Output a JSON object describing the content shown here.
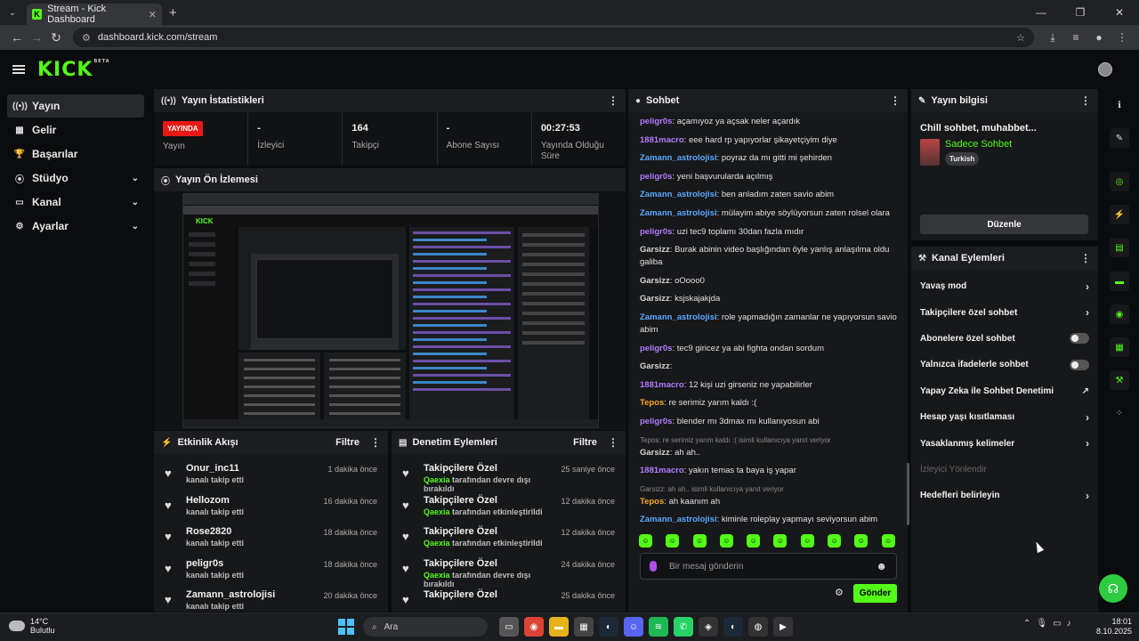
{
  "browser": {
    "tab_title": "Stream - Kick Dashboard",
    "url": "dashboard.kick.com/stream"
  },
  "brand": {
    "logo": "KICK",
    "beta": "BETA",
    "accent": "#53fc18"
  },
  "sidebar": {
    "items": [
      {
        "label": "Yayın",
        "icon": "broadcast-icon"
      },
      {
        "label": "Gelir",
        "icon": "revenue-icon"
      },
      {
        "label": "Başarılar",
        "icon": "trophy-icon"
      },
      {
        "label": "Stüdyo",
        "icon": "studio-icon"
      },
      {
        "label": "Kanal",
        "icon": "channel-icon"
      },
      {
        "label": "Ayarlar",
        "icon": "gear-icon"
      }
    ]
  },
  "stats": {
    "title": "Yayın İstatistikleri",
    "live": "YAYINDA",
    "live_label": "Yayın",
    "viewers": {
      "value": "-",
      "label": "İzleyici"
    },
    "followers": {
      "value": "164",
      "label": "Takipçi"
    },
    "subs": {
      "value": "-",
      "label": "Abone Sayısı"
    },
    "uptime": {
      "value": "00:27:53",
      "label": "Yayında Olduğu Süre"
    }
  },
  "preview": {
    "title": "Yayın Ön İzlemesi"
  },
  "activity": {
    "title": "Etkinlik Akışı",
    "filter": "Filtre",
    "items": [
      {
        "name": "Onur_inc11",
        "sub": "kanalı takip etti",
        "time": "1 dakika önce"
      },
      {
        "name": "Hellozom",
        "sub": "kanalı takip etti",
        "time": "16 dakika önce"
      },
      {
        "name": "Rose2820",
        "sub": "kanalı takip etti",
        "time": "18 dakika önce"
      },
      {
        "name": "peligr0s",
        "sub": "kanalı takip etti",
        "time": "18 dakika önce"
      },
      {
        "name": "Zamann_astrolojisi",
        "sub": "kanalı takip etti",
        "time": "20 dakika önce"
      }
    ]
  },
  "moderation": {
    "title": "Denetim Eylemleri",
    "filter": "Filtre",
    "items": [
      {
        "name": "Takipçilere Özel",
        "actor": "Qaexia",
        "sub": "tarafından devre dışı bırakıldı",
        "time": "25 saniye önce"
      },
      {
        "name": "Takipçilere Özel",
        "actor": "Qaexia",
        "sub": "tarafından etkinleştirildi",
        "time": "12 dakika önce"
      },
      {
        "name": "Takipçilere Özel",
        "actor": "Qaexia",
        "sub": "tarafından etkinleştirildi",
        "time": "12 dakika önce"
      },
      {
        "name": "Takipçilere Özel",
        "actor": "Qaexia",
        "sub": "tarafından devre dışı bırakıldı",
        "time": "24 dakika önce"
      },
      {
        "name": "Takipçilere Özel",
        "actor": "",
        "sub": "",
        "time": "25 dakika önce"
      }
    ]
  },
  "chat": {
    "title": "Sohbet",
    "placeholder": "Bir mesaj gönderin",
    "send": "Gönder",
    "messages": [
      {
        "user": "peligr0s",
        "color": "#b07cff",
        "text": "açamıyoz ya açsak neler açardık"
      },
      {
        "user": "1881macro",
        "color": "#b07cff",
        "text": "eee hard rp yapıyorlar şikayetçiyim diye"
      },
      {
        "user": "Zamann_astrolojisi",
        "color": "#5aa9ff",
        "text": "poyraz da mı gitti mi şehirden"
      },
      {
        "user": "peligr0s",
        "color": "#b07cff",
        "text": "yeni başvurularda açılmış"
      },
      {
        "user": "Zamann_astrolojisi",
        "color": "#5aa9ff",
        "text": "ben anladım zaten savio abim"
      },
      {
        "user": "Zamann_astrolojisi",
        "color": "#5aa9ff",
        "text": "mülayim abiye söylüyorsun zaten rolsel olara"
      },
      {
        "user": "peligr0s",
        "color": "#b07cff",
        "text": "uzi tec9 toplamı 30dan fazla mıdır"
      },
      {
        "user": "Garsizz",
        "color": "#d4d4d4",
        "text": "Burak abinin video başlığından öyle yanlış anlaşılma oldu galiba"
      },
      {
        "user": "Garsizz",
        "color": "#d4d4d4",
        "text": "oOooo0"
      },
      {
        "user": "Garsizz",
        "color": "#d4d4d4",
        "text": "ksjskajakjda"
      },
      {
        "user": "Zamann_astrolojisi",
        "color": "#5aa9ff",
        "text": "role yapmadığın zamanlar ne yapıyorsun savio abim"
      },
      {
        "user": "peligr0s",
        "color": "#b07cff",
        "text": "tec9 giricez ya abi fighta ondan sordum"
      },
      {
        "user": "Garsizz",
        "color": "#d4d4d4",
        "text": ""
      },
      {
        "user": "1881macro",
        "color": "#b07cff",
        "text": "12 kişi uzi girseniz ne yapabilirler"
      },
      {
        "user": "Tepos",
        "color": "#f5a623",
        "text": "re serimiz yarım kaldı :("
      },
      {
        "user": "peligr0s",
        "color": "#b07cff",
        "text": "blender mı 3dmax mı kullanıyosun abi"
      },
      {
        "reply": "Tepos: re serimiz yarım kaldı :( isimli kullanıcıya yanıt veriyor",
        "user": "Garsizz",
        "color": "#d4d4d4",
        "text": "ah ah.."
      },
      {
        "user": "1881macro",
        "color": "#b07cff",
        "text": "yakın temas ta baya iş yapar"
      },
      {
        "reply": "Garsizz: ah ah.. isimli kullanıcıya yanıt veriyor",
        "user": "Tepos",
        "color": "#f5a623",
        "text": "ah kaanım ah"
      },
      {
        "user": "Zamann_astrolojisi",
        "color": "#5aa9ff",
        "text": "kiminle roleplay yapmayı seviyorsun abim"
      }
    ]
  },
  "info": {
    "title": "Yayın bilgisi",
    "stream_title": "Chill sohbet, muhabbet...",
    "mode": "Sadece Sohbet",
    "tag": "Turkish",
    "edit": "Düzenle"
  },
  "actions": {
    "title": "Kanal Eylemleri",
    "items": [
      {
        "label": "Yavaş mod",
        "control": "chevron"
      },
      {
        "label": "Takipçilere özel sohbet",
        "control": "chevron"
      },
      {
        "label": "Abonelere özel sohbet",
        "control": "toggle"
      },
      {
        "label": "Yalnızca ifadelerle sohbet",
        "control": "toggle"
      },
      {
        "label": "Yapay Zeka ile Sohbet Denetimi",
        "control": "external"
      },
      {
        "label": "Hesap yaşı kısıtlaması",
        "control": "chevron"
      },
      {
        "label": "Yasaklanmış kelimeler",
        "control": "chevron"
      },
      {
        "label": "İzleyici Yönlendir",
        "control": "none"
      },
      {
        "label": "Hedefleri belirleyin",
        "control": "chevron"
      }
    ]
  },
  "taskbar": {
    "temp": "14°C",
    "weather": "Bulutlu",
    "search": "Ara",
    "time": "18:01",
    "date": "8.10.2025"
  }
}
